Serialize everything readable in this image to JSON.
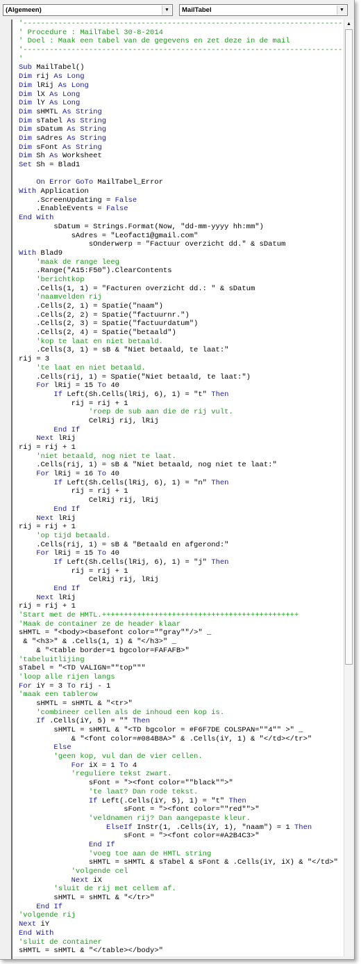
{
  "toolbar": {
    "object_combo": "(Algemeen)",
    "procedure_combo": "MailTabel"
  },
  "icons": {
    "dropdown": "triangle-down-icon",
    "scroll_up": "triangle-up-icon"
  },
  "colors": {
    "keyword": "#1a1a9c",
    "comment": "#1d9a1d",
    "text": "#000000"
  },
  "keywords": [
    "Sub",
    "Dim",
    "As",
    "Long",
    "String",
    "Set",
    "On",
    "Error",
    "GoTo",
    "With",
    "False",
    "End",
    "If",
    "Then",
    "For",
    "To",
    "Next",
    "Else",
    "ElseIf"
  ],
  "code_lines": [
    "'--------------------------------------------------------------------------------",
    "' Procedure : MailTabel 30-8-2014",
    "' Doel : Maak een tabel van de gegevens en zet deze in de mail",
    "'--------------------------------------------------------------------------------",
    "'",
    "Sub MailTabel()",
    "Dim rij As Long",
    "Dim lRij As Long",
    "Dim lX As Long",
    "Dim lY As Long",
    "Dim sHMTL As String",
    "Dim sTabel As String",
    "Dim sDatum As String",
    "Dim sAdres As String",
    "Dim sFont As String",
    "Dim Sh As Worksheet",
    "Set Sh = Blad1",
    "",
    "    On Error GoTo MailTabel_Error",
    "With Application",
    "    .ScreenUpdating = False",
    "    .EnableEvents = False",
    "End With",
    "        sDatum = Strings.Format(Now, \"dd-mm-yyyy hh:mm\")",
    "            sAdres = \"Leofact1@gmail.com\"",
    "                sOnderwerp = \"Factuur overzicht dd.\" & sDatum",
    "With Blad9",
    "    'maak de range leeg",
    "    .Range(\"A15:F50\").ClearContents",
    "    'berichtkop",
    "    .Cells(1, 1) = \"Facturen overzicht dd.: \" & sDatum",
    "    'naamvelden rij",
    "    .Cells(2, 1) = Spatie(\"naam\")",
    "    .Cells(2, 2) = Spatie(\"factuurnr.\")",
    "    .Cells(2, 3) = Spatie(\"factuurdatum\")",
    "    .Cells(2, 4) = Spatie(\"betaald\")",
    "    'kop te laat en niet betaald.",
    "    .Cells(3, 1) = sB & \"Niet betaald, te laat:\"",
    "rij = 3",
    "    'te laat en niet betaald.",
    "    .Cells(rij, 1) = Spatie(\"Niet betaald, te laat:\")",
    "    For lRij = 15 To 40",
    "        If Left(Sh.Cells(lRij, 6), 1) = \"t\" Then",
    "            rij = rij + 1",
    "                'roep de sub aan die de rij vult.",
    "                CelRij rij, lRij",
    "        End If",
    "    Next lRij",
    "rij = rij + 1",
    "    'niet betaald, nog niet te laat.",
    "    .Cells(rij, 1) = sB & \"Niet betaald, nog niet te laat:\"",
    "    For lRij = 16 To 40",
    "        If Left(Sh.Cells(lRij, 6), 1) = \"n\" Then",
    "            rij = rij + 1",
    "                CelRij rij, lRij",
    "        End If",
    "    Next lRij",
    "rij = rij + 1",
    "    'op tijd betaald.",
    "    .Cells(rij, 1) = sB & \"Betaald en afgerond:\"",
    "    For lRij = 15 To 40",
    "        If Left(Sh.Cells(lRij, 6), 1) = \"j\" Then",
    "            rij = rij + 1",
    "                CelRij rij, lRij",
    "        End If",
    "    Next lRij",
    "rij = rij + 1",
    "'Start met de HMTL.+++++++++++++++++++++++++++++++++++++++++++++",
    "'Maak de container ze de header klaar",
    "sHMTL = \"<body><basefont color=\"\"gray\"\"/>\" _",
    " & \"<h3>\" & .Cells(1, 1) & \"</h3>\" _",
    "    & \"<table border=1 bgcolor=FAFAFB>\"",
    "'tabeluitlijing",
    "sTabel = \"<TD VALIGN=\"\"top\"\"\"",
    "'loop alle rijen langs",
    "For iY = 3 To rij - 1",
    "'maak een tablerow",
    "    sHMTL = sHMTL & \"<tr>\"",
    "    'combineer cellen als de inhoud een kop is.",
    "    If .Cells(iY, 5) = \"\" Then",
    "        sHMTL = sHMTL & \"<TD bgcolor = #F6F7DE COLSPAN=\"\"4\"\" >\" _",
    "            & \"<font color=#084B8A>\" & .Cells(iY, 1) & \"</td></tr>\"",
    "        Else",
    "        'geen kop, vul dan de vier cellen.",
    "            For iX = 1 To 4",
    "            'reguliere tekst zwart.",
    "                sFont = \"><font color=\"\"black\"\">\"",
    "                'te laat? Dan rode tekst.",
    "                If Left(.Cells(iY, 5), 1) = \"t\" Then",
    "                        sFont = \"><font color=\"\"red\"\">\"",
    "                'veldnamen rij? Dan aangepaste kleur.",
    "                    ElseIf InStr(1, .Cells(iY, 1), \"naam\") = 1 Then",
    "                        sFont = \"><font color=#A2B4C3>\"",
    "                End If",
    "                'voeg toe aan de HMTL string",
    "                sHMTL = sHMTL & sTabel & sFont & .Cells(iY, iX) & \"</td>\"",
    "            'volgende cel",
    "            Next iX",
    "        'sluit de rij met cellem af.",
    "        sHMTL = sHMTL & \"</tr>\"",
    "    End If",
    "'volgende rij",
    "Next iY",
    "End With",
    "'sluit de container",
    "sHMTL = sHMTL & \"</table></body>\""
  ]
}
